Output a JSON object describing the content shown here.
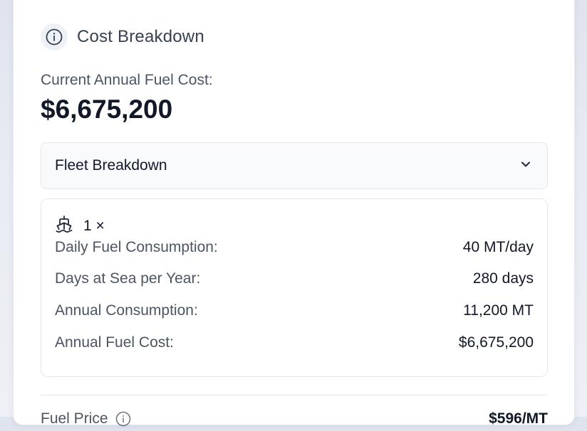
{
  "header": {
    "icon": "info-icon",
    "title": "Cost Breakdown"
  },
  "current_cost": {
    "label": "Current Annual Fuel Cost:",
    "value": "$6,675,200"
  },
  "fleet_dropdown": {
    "label": "Fleet Breakdown",
    "icon": "chevron-down-icon"
  },
  "vessel": {
    "icon": "ship-icon",
    "count_label": "1 ×",
    "rows": [
      {
        "label": "Daily Fuel Consumption:",
        "value": "40 MT/day"
      },
      {
        "label": "Days at Sea per Year:",
        "value": "280 days"
      },
      {
        "label": "Annual Consumption:",
        "value": "11,200 MT"
      },
      {
        "label": "Annual Fuel Cost:",
        "value": "$6,675,200"
      }
    ]
  },
  "fuel_price": {
    "label": "Fuel Price",
    "icon": "info-icon",
    "value": "$596/MT"
  }
}
